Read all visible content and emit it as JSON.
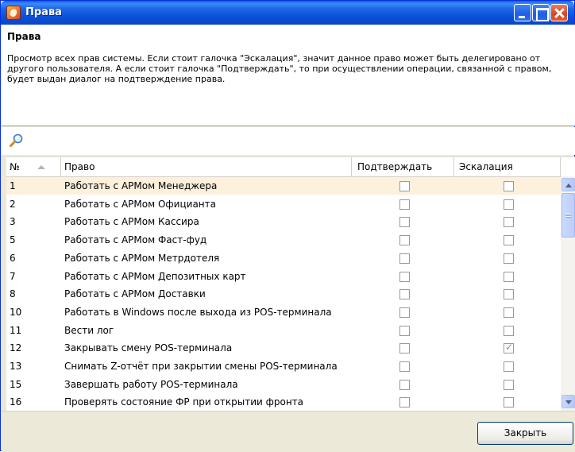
{
  "window": {
    "title": "Права"
  },
  "header": {
    "title": "Права",
    "description": "Просмотр всех прав системы. Если стоит галочка \"Эскалация\", значит данное право может быть делегировано от другого пользователя. А если стоит галочка \"Подтверждать\", то при осуществлении операции, связанной с правом, будет выдан диалог на подтверждение права."
  },
  "grid": {
    "columns": {
      "no": "№",
      "right": "Право",
      "confirm": "Подтверждать",
      "escalation": "Эскалация"
    },
    "rows": [
      {
        "no": "1",
        "right": "Работать с АРМом Менеджера",
        "confirm": false,
        "escalation": false,
        "selected": true
      },
      {
        "no": "2",
        "right": "Работать с АРМом Официанта",
        "confirm": false,
        "escalation": false
      },
      {
        "no": "3",
        "right": "Работать с АРМом Кассира",
        "confirm": false,
        "escalation": false
      },
      {
        "no": "5",
        "right": "Работать с АРМом Фаст-фуд",
        "confirm": false,
        "escalation": false
      },
      {
        "no": "6",
        "right": "Работать с АРМом Метрдотеля",
        "confirm": false,
        "escalation": false
      },
      {
        "no": "7",
        "right": "Работать с АРМом Депозитных карт",
        "confirm": false,
        "escalation": false
      },
      {
        "no": "8",
        "right": "Работать с АРМом Доставки",
        "confirm": false,
        "escalation": false
      },
      {
        "no": "10",
        "right": "Работать в Windows после выхода из POS-терминала",
        "confirm": false,
        "escalation": false
      },
      {
        "no": "11",
        "right": "Вести лог",
        "confirm": false,
        "escalation": false
      },
      {
        "no": "12",
        "right": "Закрывать смену POS-терминала",
        "confirm": false,
        "escalation": true
      },
      {
        "no": "13",
        "right": "Снимать Z-отчёт при закрытии смены POS-терминала",
        "confirm": false,
        "escalation": false
      },
      {
        "no": "15",
        "right": "Завершать работу POS-терминала",
        "confirm": false,
        "escalation": false
      },
      {
        "no": "16",
        "right": "Проверять состояние ФР при открытии фронта",
        "confirm": false,
        "escalation": false
      }
    ]
  },
  "footer": {
    "close_label": "Закрыть"
  }
}
